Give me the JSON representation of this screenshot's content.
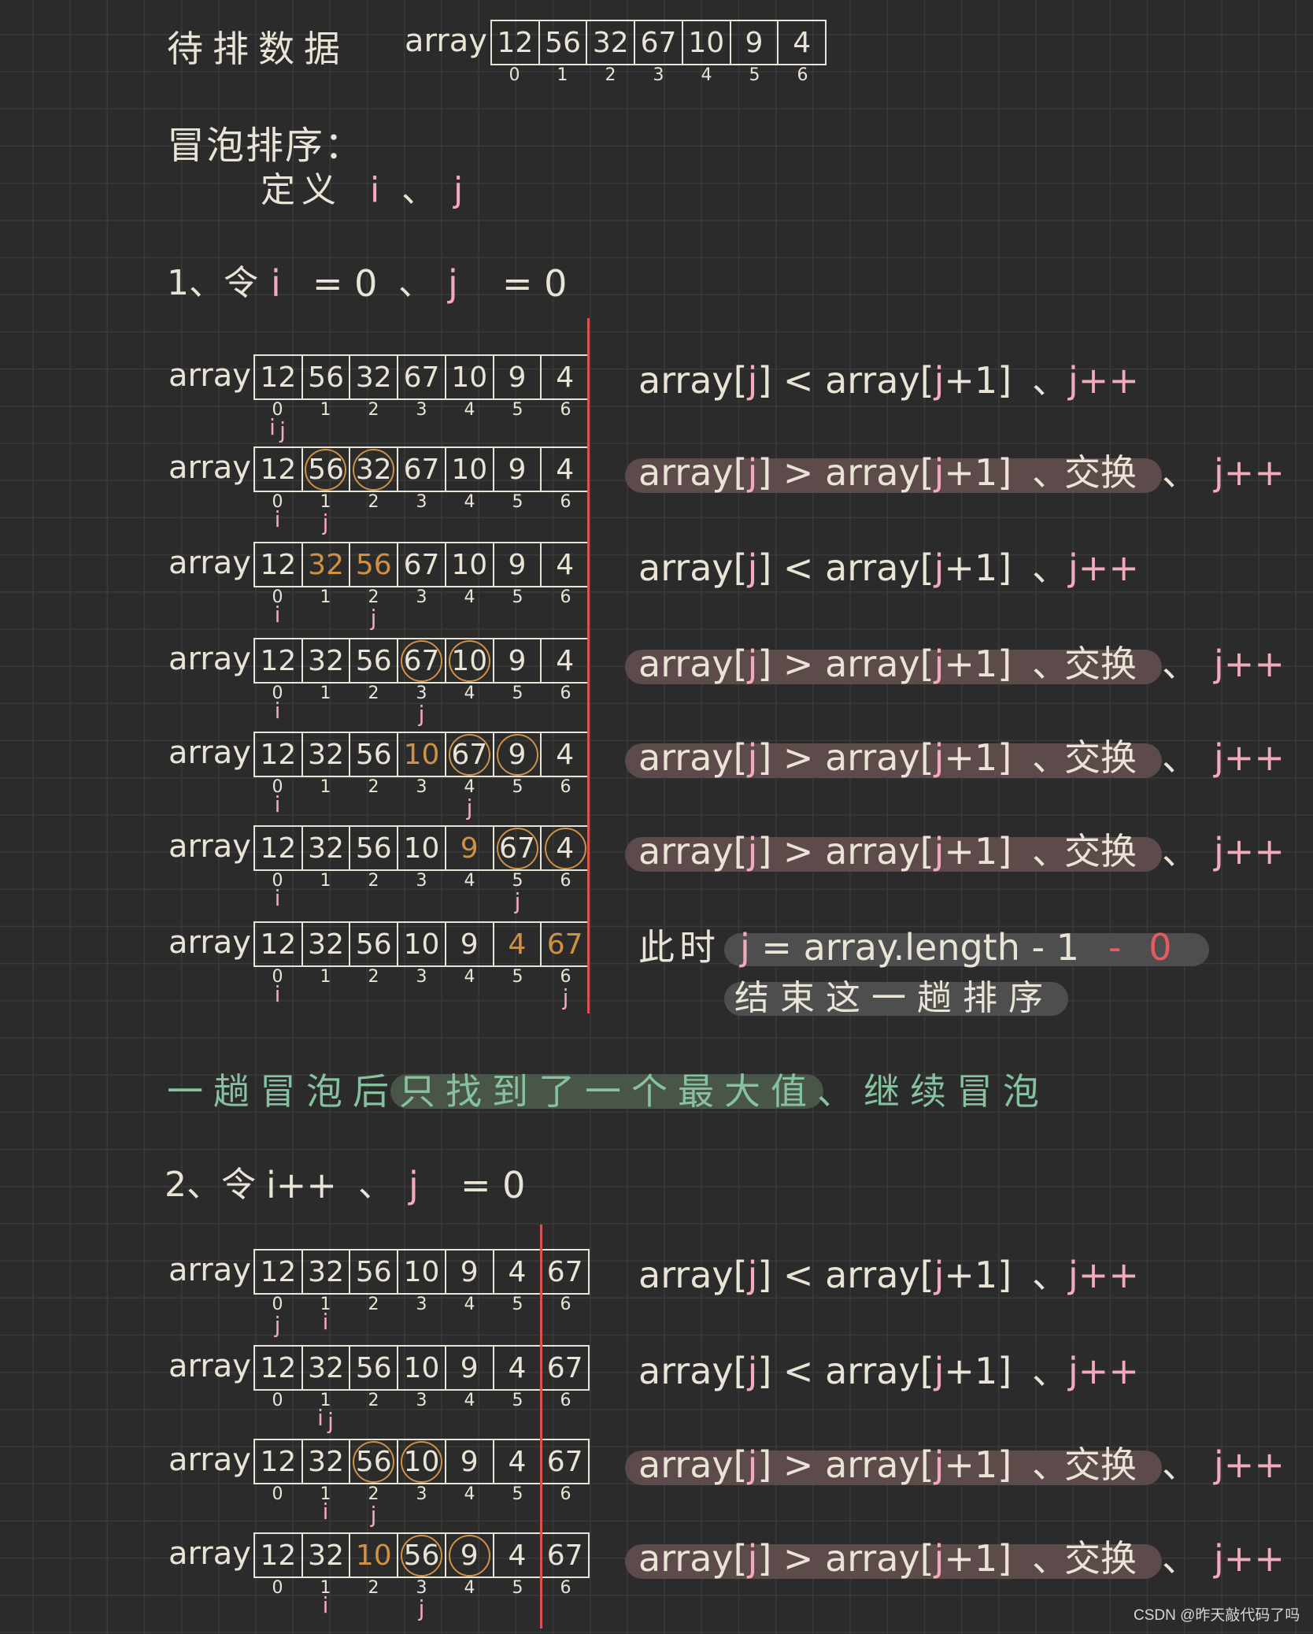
{
  "title": "待排数据",
  "array_label": "array",
  "indices": [
    0,
    1,
    2,
    3,
    4,
    5,
    6
  ],
  "unsorted_values": [
    12,
    56,
    32,
    67,
    10,
    9,
    4
  ],
  "bubble_sort": {
    "title": "冒泡排序：",
    "define": "定义",
    "i": "i",
    "sep": "、",
    "j": "j"
  },
  "step1": {
    "prefix": "1、令",
    "i": "i",
    "i_value": "= 0",
    "sep": "、",
    "j": "j",
    "j_value": "= 0"
  },
  "pass1_rows": [
    {
      "values": [
        12,
        56,
        32,
        67,
        10,
        9,
        4
      ],
      "orange": [],
      "circled": [],
      "pointers": [
        {
          "label": "i",
          "index": 0
        },
        {
          "label": "j",
          "index": 0
        }
      ],
      "note": {
        "expr": "array[j] < array[j+1]",
        "sep": "、",
        "inc": "j++",
        "highlight": false
      }
    },
    {
      "values": [
        12,
        56,
        32,
        67,
        10,
        9,
        4
      ],
      "orange": [],
      "circled": [
        1,
        2
      ],
      "pointers": [
        {
          "label": "i",
          "index": 0
        },
        {
          "label": "j",
          "index": 1
        }
      ],
      "note": {
        "expr": "array[j] > array[j+1]",
        "sep": "、",
        "swap": "交换",
        "inc": "j++",
        "highlight": true
      }
    },
    {
      "values": [
        12,
        32,
        56,
        67,
        10,
        9,
        4
      ],
      "orange": [
        1,
        2
      ],
      "circled": [],
      "pointers": [
        {
          "label": "i",
          "index": 0
        },
        {
          "label": "j",
          "index": 2
        }
      ],
      "note": {
        "expr": "array[j] < array[j+1]",
        "sep": "、",
        "inc": "j++",
        "highlight": false
      }
    },
    {
      "values": [
        12,
        32,
        56,
        67,
        10,
        9,
        4
      ],
      "orange": [],
      "circled": [
        3,
        4
      ],
      "pointers": [
        {
          "label": "i",
          "index": 0
        },
        {
          "label": "j",
          "index": 3
        }
      ],
      "note": {
        "expr": "array[j] > array[j+1]",
        "sep": "、",
        "swap": "交换",
        "inc": "j++",
        "highlight": true
      }
    },
    {
      "values": [
        12,
        32,
        56,
        10,
        67,
        9,
        4
      ],
      "orange": [
        3
      ],
      "circled": [
        4,
        5
      ],
      "pointers": [
        {
          "label": "i",
          "index": 0
        },
        {
          "label": "j",
          "index": 4
        }
      ],
      "note": {
        "expr": "array[j] > array[j+1]",
        "sep": "、",
        "swap": "交换",
        "inc": "j++",
        "highlight": true
      }
    },
    {
      "values": [
        12,
        32,
        56,
        10,
        9,
        67,
        4
      ],
      "orange": [
        4
      ],
      "circled": [
        5,
        6
      ],
      "pointers": [
        {
          "label": "i",
          "index": 0
        },
        {
          "label": "j",
          "index": 5
        }
      ],
      "note": {
        "expr": "array[j] > array[j+1]",
        "sep": "、",
        "swap": "交换",
        "inc": "j++",
        "highlight": true
      }
    },
    {
      "values": [
        12,
        32,
        56,
        10,
        9,
        4,
        67
      ],
      "orange": [
        5,
        6
      ],
      "circled": [],
      "pointers": [
        {
          "label": "i",
          "index": 0
        },
        {
          "label": "j",
          "index": 6
        }
      ],
      "note": {
        "prefix": "此时",
        "expr": "j = array.length - 1",
        "tail": "- 0",
        "line2": "结束这一趟排序"
      }
    }
  ],
  "summary": {
    "before": "一趟冒泡后",
    "highlighted": "只找到了一个最大值",
    "after": "、继续冒泡"
  },
  "step2": {
    "prefix": "2、令",
    "i": "i++",
    "sep": "、",
    "j": "j",
    "j_value": "= 0"
  },
  "pass2_rows": [
    {
      "values": [
        12,
        32,
        56,
        10,
        9,
        4,
        67
      ],
      "orange": [],
      "circled": [],
      "pointers": [
        {
          "label": "j",
          "index": 0
        },
        {
          "label": "i",
          "index": 1
        }
      ],
      "note": {
        "expr": "array[j] < array[j+1]",
        "sep": "、",
        "inc": "j++",
        "highlight": false
      }
    },
    {
      "values": [
        12,
        32,
        56,
        10,
        9,
        4,
        67
      ],
      "orange": [],
      "circled": [],
      "pointers": [
        {
          "label": "i",
          "index": 1
        },
        {
          "label": "j",
          "index": 1
        }
      ],
      "note": {
        "expr": "array[j] < array[j+1]",
        "sep": "、",
        "inc": "j++",
        "highlight": false
      }
    },
    {
      "values": [
        12,
        32,
        56,
        10,
        9,
        4,
        67
      ],
      "orange": [],
      "circled": [
        2,
        3
      ],
      "pointers": [
        {
          "label": "i",
          "index": 1
        },
        {
          "label": "j",
          "index": 2
        }
      ],
      "note": {
        "expr": "array[j] > array[j+1]",
        "sep": "、",
        "swap": "交换",
        "inc": "j++",
        "highlight": true
      }
    },
    {
      "values": [
        12,
        32,
        10,
        56,
        9,
        4,
        67
      ],
      "orange": [
        2
      ],
      "circled": [
        3,
        4
      ],
      "pointers": [
        {
          "label": "i",
          "index": 1
        },
        {
          "label": "j",
          "index": 3
        }
      ],
      "note": {
        "expr": "array[j] > array[j+1]",
        "sep": "、",
        "swap": "交换",
        "inc": "j++",
        "highlight": true
      }
    }
  ],
  "watermark": "CSDN @昨天敲代码了吗",
  "colors": {
    "background": "#2b2b2b",
    "grid": "#3a3a3a",
    "ink": "#e9e4d6",
    "pointer": "#f3aabb",
    "accent_orange": "#cf9146",
    "divider_red": "#d9534f",
    "swap_highlight": "#5d4a4b",
    "note_highlight": "#4e4e4e",
    "summary_text": "#86c2a0",
    "summary_highlight": "#4a5549",
    "tail_red": "#e65a62",
    "watermark": "#d6d6d6"
  }
}
